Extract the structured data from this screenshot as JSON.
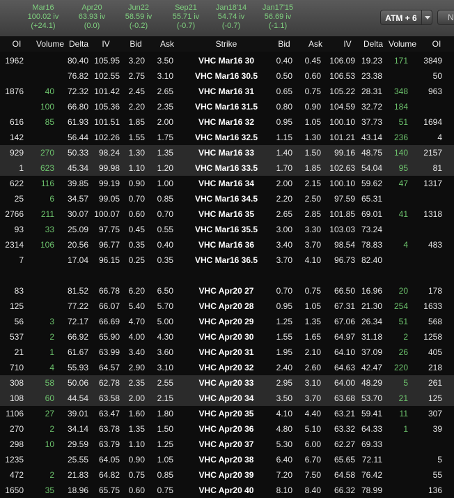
{
  "expirations": [
    {
      "name": "Mar16",
      "iv": "100.02 iv",
      "change": "(+24.1)"
    },
    {
      "name": "Apr20",
      "iv": "63.93 iv",
      "change": "(0.0)"
    },
    {
      "name": "Jun22",
      "iv": "58.59 iv",
      "change": "(-0.2)"
    },
    {
      "name": "Sep21",
      "iv": "55.71 iv",
      "change": "(-0.7)"
    },
    {
      "name": "Jan18'14",
      "iv": "54.74 iv",
      "change": "(-0.7)"
    },
    {
      "name": "Jan17'15",
      "iv": "56.69 iv",
      "change": "(-1.1)"
    }
  ],
  "toolbar": {
    "atm_label": "ATM + 6",
    "next_label": "Ne"
  },
  "columns": [
    "OI",
    "Volume",
    "Delta",
    "IV",
    "Bid",
    "Ask",
    "Strike",
    "Bid",
    "Ask",
    "IV",
    "Delta",
    "Volume",
    "OI"
  ],
  "rows": [
    [
      "1962",
      "",
      "80.40",
      "105.95",
      "3.20",
      "3.50",
      "VHC Mar16 30",
      "0.40",
      "0.45",
      "106.09",
      "19.23",
      "171",
      "3849"
    ],
    [
      "",
      "",
      "76.82",
      "102.55",
      "2.75",
      "3.10",
      "VHC Mar16 30.5",
      "0.50",
      "0.60",
      "106.53",
      "23.38",
      "",
      "50"
    ],
    [
      "1876",
      "40",
      "72.32",
      "101.42",
      "2.45",
      "2.65",
      "VHC Mar16 31",
      "0.65",
      "0.75",
      "105.22",
      "28.31",
      "348",
      "963"
    ],
    [
      "",
      "100",
      "66.80",
      "105.36",
      "2.20",
      "2.35",
      "VHC Mar16 31.5",
      "0.80",
      "0.90",
      "104.59",
      "32.72",
      "184",
      ""
    ],
    [
      "616",
      "85",
      "61.93",
      "101.51",
      "1.85",
      "2.00",
      "VHC Mar16 32",
      "0.95",
      "1.05",
      "100.10",
      "37.73",
      "51",
      "1694"
    ],
    [
      "142",
      "",
      "56.44",
      "102.26",
      "1.55",
      "1.75",
      "VHC Mar16 32.5",
      "1.15",
      "1.30",
      "101.21",
      "43.14",
      "236",
      "4"
    ],
    [
      "929",
      "270",
      "50.33",
      "98.24",
      "1.30",
      "1.35",
      "VHC Mar16 33",
      "1.40",
      "1.50",
      "99.16",
      "48.75",
      "140",
      "2157"
    ],
    [
      "1",
      "623",
      "45.34",
      "99.98",
      "1.10",
      "1.20",
      "VHC Mar16 33.5",
      "1.70",
      "1.85",
      "102.63",
      "54.04",
      "95",
      "81"
    ],
    [
      "622",
      "116",
      "39.85",
      "99.19",
      "0.90",
      "1.00",
      "VHC Mar16 34",
      "2.00",
      "2.15",
      "100.10",
      "59.62",
      "47",
      "1317"
    ],
    [
      "25",
      "6",
      "34.57",
      "99.05",
      "0.70",
      "0.85",
      "VHC Mar16 34.5",
      "2.20",
      "2.50",
      "97.59",
      "65.31",
      "",
      ""
    ],
    [
      "2766",
      "211",
      "30.07",
      "100.07",
      "0.60",
      "0.70",
      "VHC Mar16 35",
      "2.65",
      "2.85",
      "101.85",
      "69.01",
      "41",
      "1318"
    ],
    [
      "93",
      "33",
      "25.09",
      "97.75",
      "0.45",
      "0.55",
      "VHC Mar16 35.5",
      "3.00",
      "3.30",
      "103.03",
      "73.24",
      "",
      ""
    ],
    [
      "2314",
      "106",
      "20.56",
      "96.77",
      "0.35",
      "0.40",
      "VHC Mar16 36",
      "3.40",
      "3.70",
      "98.54",
      "78.83",
      "4",
      "483"
    ],
    [
      "7",
      "",
      "17.04",
      "96.15",
      "0.25",
      "0.35",
      "VHC Mar16 36.5",
      "3.70",
      "4.10",
      "96.73",
      "82.40",
      "",
      ""
    ],
    [
      "83",
      "",
      "81.52",
      "66.78",
      "6.20",
      "6.50",
      "VHC Apr20 27",
      "0.70",
      "0.75",
      "66.50",
      "16.96",
      "20",
      "178"
    ],
    [
      "125",
      "",
      "77.22",
      "66.07",
      "5.40",
      "5.70",
      "VHC Apr20 28",
      "0.95",
      "1.05",
      "67.31",
      "21.30",
      "254",
      "1633"
    ],
    [
      "56",
      "3",
      "72.17",
      "66.69",
      "4.70",
      "5.00",
      "VHC Apr20 29",
      "1.25",
      "1.35",
      "67.06",
      "26.34",
      "51",
      "568"
    ],
    [
      "537",
      "2",
      "66.92",
      "65.90",
      "4.00",
      "4.30",
      "VHC Apr20 30",
      "1.55",
      "1.65",
      "64.97",
      "31.18",
      "2",
      "1258"
    ],
    [
      "21",
      "1",
      "61.67",
      "63.99",
      "3.40",
      "3.60",
      "VHC Apr20 31",
      "1.95",
      "2.10",
      "64.10",
      "37.09",
      "26",
      "405"
    ],
    [
      "710",
      "4",
      "55.93",
      "64.57",
      "2.90",
      "3.10",
      "VHC Apr20 32",
      "2.40",
      "2.60",
      "64.63",
      "42.47",
      "220",
      "218"
    ],
    [
      "308",
      "58",
      "50.06",
      "62.78",
      "2.35",
      "2.55",
      "VHC Apr20 33",
      "2.95",
      "3.10",
      "64.00",
      "48.29",
      "5",
      "261"
    ],
    [
      "108",
      "60",
      "44.54",
      "63.58",
      "2.00",
      "2.15",
      "VHC Apr20 34",
      "3.50",
      "3.70",
      "63.68",
      "53.70",
      "21",
      "125"
    ],
    [
      "1106",
      "27",
      "39.01",
      "63.47",
      "1.60",
      "1.80",
      "VHC Apr20 35",
      "4.10",
      "4.40",
      "63.21",
      "59.41",
      "11",
      "307"
    ],
    [
      "270",
      "2",
      "34.14",
      "63.78",
      "1.35",
      "1.50",
      "VHC Apr20 36",
      "4.80",
      "5.10",
      "63.32",
      "64.33",
      "1",
      "39"
    ],
    [
      "298",
      "10",
      "29.59",
      "63.79",
      "1.10",
      "1.25",
      "VHC Apr20 37",
      "5.30",
      "6.00",
      "62.27",
      "69.33",
      "",
      ""
    ],
    [
      "1235",
      "",
      "25.55",
      "64.05",
      "0.90",
      "1.05",
      "VHC Apr20 38",
      "6.40",
      "6.70",
      "65.65",
      "72.11",
      "",
      "5"
    ],
    [
      "472",
      "2",
      "21.83",
      "64.82",
      "0.75",
      "0.85",
      "VHC Apr20 39",
      "7.20",
      "7.50",
      "64.58",
      "76.42",
      "",
      "55"
    ],
    [
      "1650",
      "35",
      "18.96",
      "65.75",
      "0.60",
      "0.75",
      "VHC Apr20 40",
      "8.10",
      "8.40",
      "66.32",
      "78.99",
      "",
      "136"
    ]
  ],
  "highlighted_rows": [
    6,
    7,
    20,
    21
  ],
  "colors": {
    "accent_green": "#7fd07f",
    "volume_green": "#6cc26c",
    "highlight": "#2b2b2b"
  }
}
